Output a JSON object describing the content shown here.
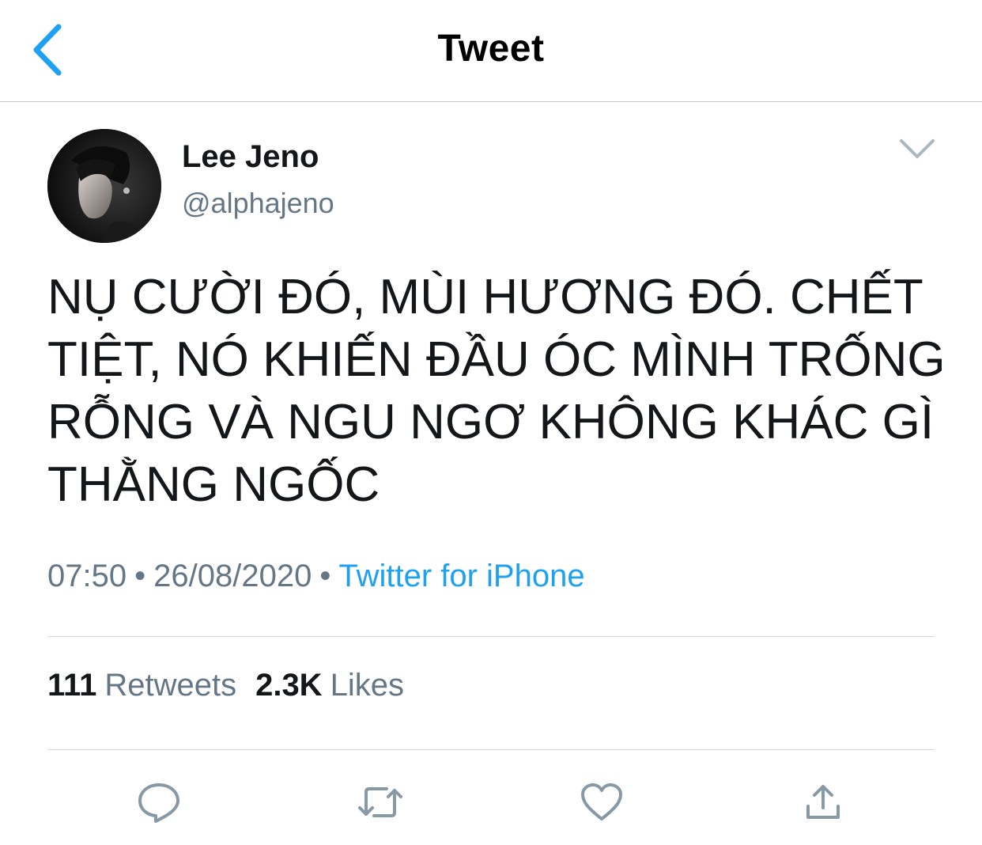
{
  "header": {
    "title": "Tweet",
    "back_icon": "chevron-left-icon"
  },
  "author": {
    "display_name": "Lee Jeno",
    "handle": "@alphajeno"
  },
  "tweet": {
    "text": "NỤ CƯỜI ĐÓ, MÙI HƯƠNG ĐÓ. CHẾT TIỆT, NÓ KHIẾN ĐẦU ÓC MÌNH TRỐNG RỖNG VÀ NGU NGƠ KHÔNG KHÁC GÌ THẰNG NGỐC",
    "time": "07:50",
    "date": "26/08/2020",
    "separator": "•",
    "source": "Twitter for iPhone"
  },
  "stats": {
    "retweets_count": "111",
    "retweets_label": "Retweets",
    "likes_count": "2.3K",
    "likes_label": "Likes"
  },
  "actions": {
    "icons": [
      "reply-icon",
      "retweet-icon",
      "like-icon",
      "share-icon"
    ]
  },
  "colors": {
    "accent": "#1da1f2",
    "secondary_text": "#657786",
    "primary_text": "#14171a",
    "icon": "#8899a6"
  }
}
